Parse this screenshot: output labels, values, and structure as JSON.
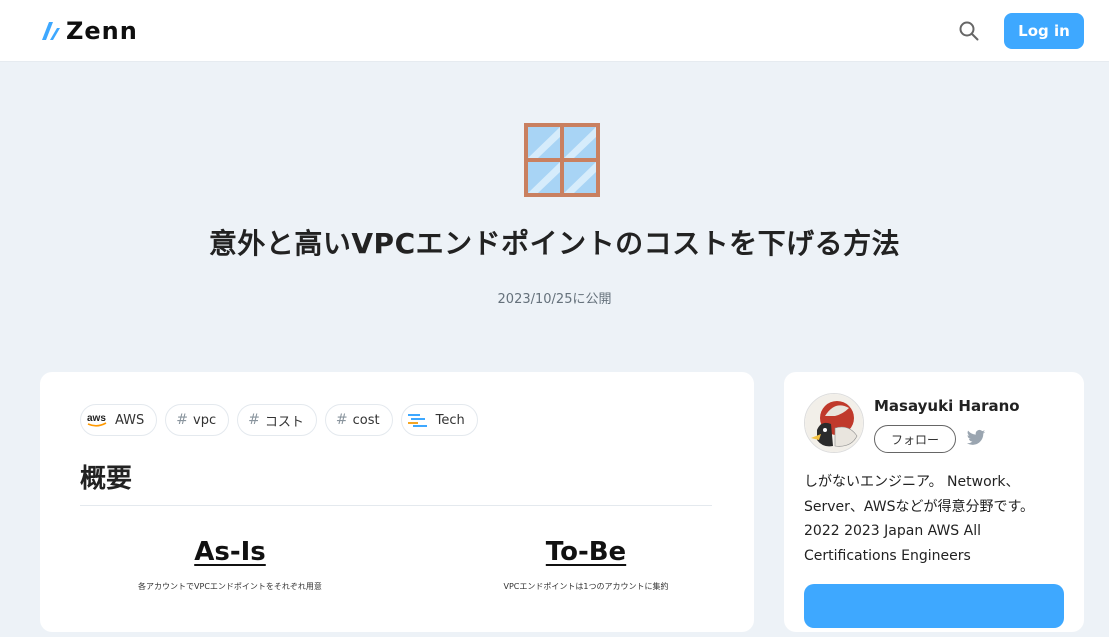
{
  "header": {
    "logo_text": "Zenn",
    "search_icon": "search-icon",
    "login_label": "Log in",
    "accent_color": "#3ea8ff"
  },
  "article": {
    "emoji": "window-emoji",
    "title": "意外と高いVPCエンドポイントのコストを下げる方法",
    "published": "2023/10/25に公開",
    "topics": [
      {
        "label": "AWS",
        "icon": "aws-icon"
      },
      {
        "label": "vpc",
        "icon": "hash"
      },
      {
        "label": "コスト",
        "icon": "hash"
      },
      {
        "label": "cost",
        "icon": "hash"
      },
      {
        "label": "Tech",
        "icon": "tech-icon"
      }
    ],
    "section_heading": "概要",
    "diagram": {
      "left_title": "As-Is",
      "left_caption": "各アカウントでVPCエンドポイントをそれぞれ用意",
      "right_title": "To-Be",
      "right_caption": "VPCエンドポイントは1つのアカウントに集約"
    }
  },
  "author": {
    "name": "Masayuki Harano",
    "follow_label": "フォロー",
    "twitter_icon": "twitter-icon",
    "bio_lines": [
      "しがないエンジニア。 Network、",
      "Server、AWSなどが得意分野です。",
      "2022 2023 Japan AWS All",
      "Certifications Engineers"
    ]
  }
}
